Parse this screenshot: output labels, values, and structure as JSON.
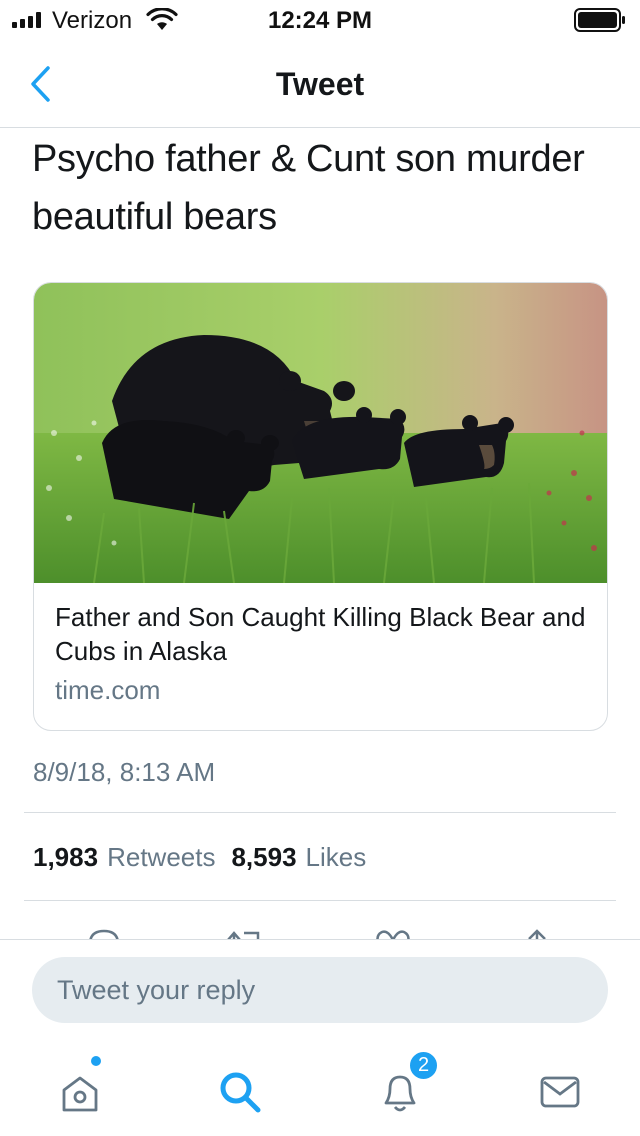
{
  "status_bar": {
    "carrier": "Verizon",
    "time": "12:24 PM",
    "signal_bars": 4,
    "battery_level": 1.0
  },
  "nav": {
    "title": "Tweet",
    "back_icon": "chevron-left-icon"
  },
  "tweet": {
    "text": "Psycho father & Cunt son murder beautiful bears",
    "card": {
      "title": "Father and Son Caught Killing Black Bear and Cubs in Alaska",
      "domain": "time.com",
      "image": "black bear and three cubs in grassy meadow"
    },
    "timestamp": "8/9/18, 8:13 AM",
    "stats": {
      "retweets_count": "1,983",
      "retweets_label": "Retweets",
      "likes_count": "8,593",
      "likes_label": "Likes"
    },
    "actions": [
      "reply-icon",
      "retweet-icon",
      "like-icon",
      "share-icon"
    ]
  },
  "reply": {
    "placeholder": "Tweet your reply"
  },
  "tab_bar": {
    "tabs": [
      "home-icon",
      "search-icon",
      "notifications-icon",
      "messages-icon"
    ],
    "notifications_badge": "2"
  },
  "colors": {
    "accent": "#1da1f2",
    "text_primary": "#14171a",
    "text_secondary": "#657786",
    "divider": "#d8dde1",
    "input_bg": "#e6ecf0"
  }
}
